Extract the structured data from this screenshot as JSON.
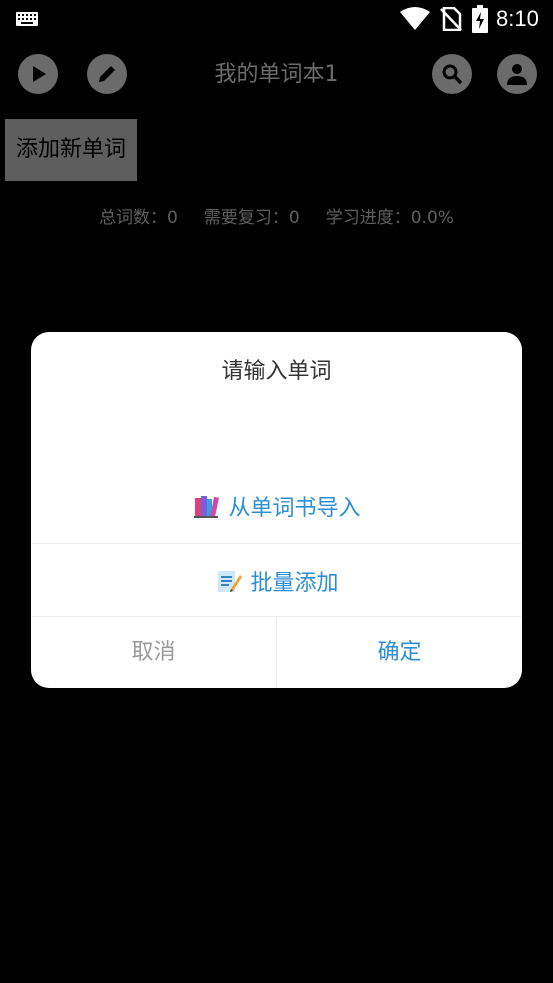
{
  "status_bar": {
    "time": "8:10",
    "icons": [
      "keyboard-icon",
      "wifi-icon",
      "no-sim-icon",
      "battery-charging-icon"
    ]
  },
  "app_bar": {
    "title": "我的单词本1",
    "left_icons": [
      "play-icon",
      "pencil-icon"
    ],
    "right_icons": [
      "search-icon",
      "account-icon"
    ]
  },
  "add_word_button": {
    "label": "添加新单词"
  },
  "stats": {
    "total": "总词数：0",
    "review": "需要复习：0",
    "progress": "学习进度：0.0%"
  },
  "dialog": {
    "title": "请输入单词",
    "input_value": "",
    "import_option": "从单词书导入",
    "batch_option": "批量添加",
    "cancel": "取消",
    "ok": "确定"
  },
  "colors": {
    "background": "#000000",
    "accent": "#2c8fd6",
    "dialog_bg": "#ffffff",
    "muted": "#9a9a9a"
  }
}
